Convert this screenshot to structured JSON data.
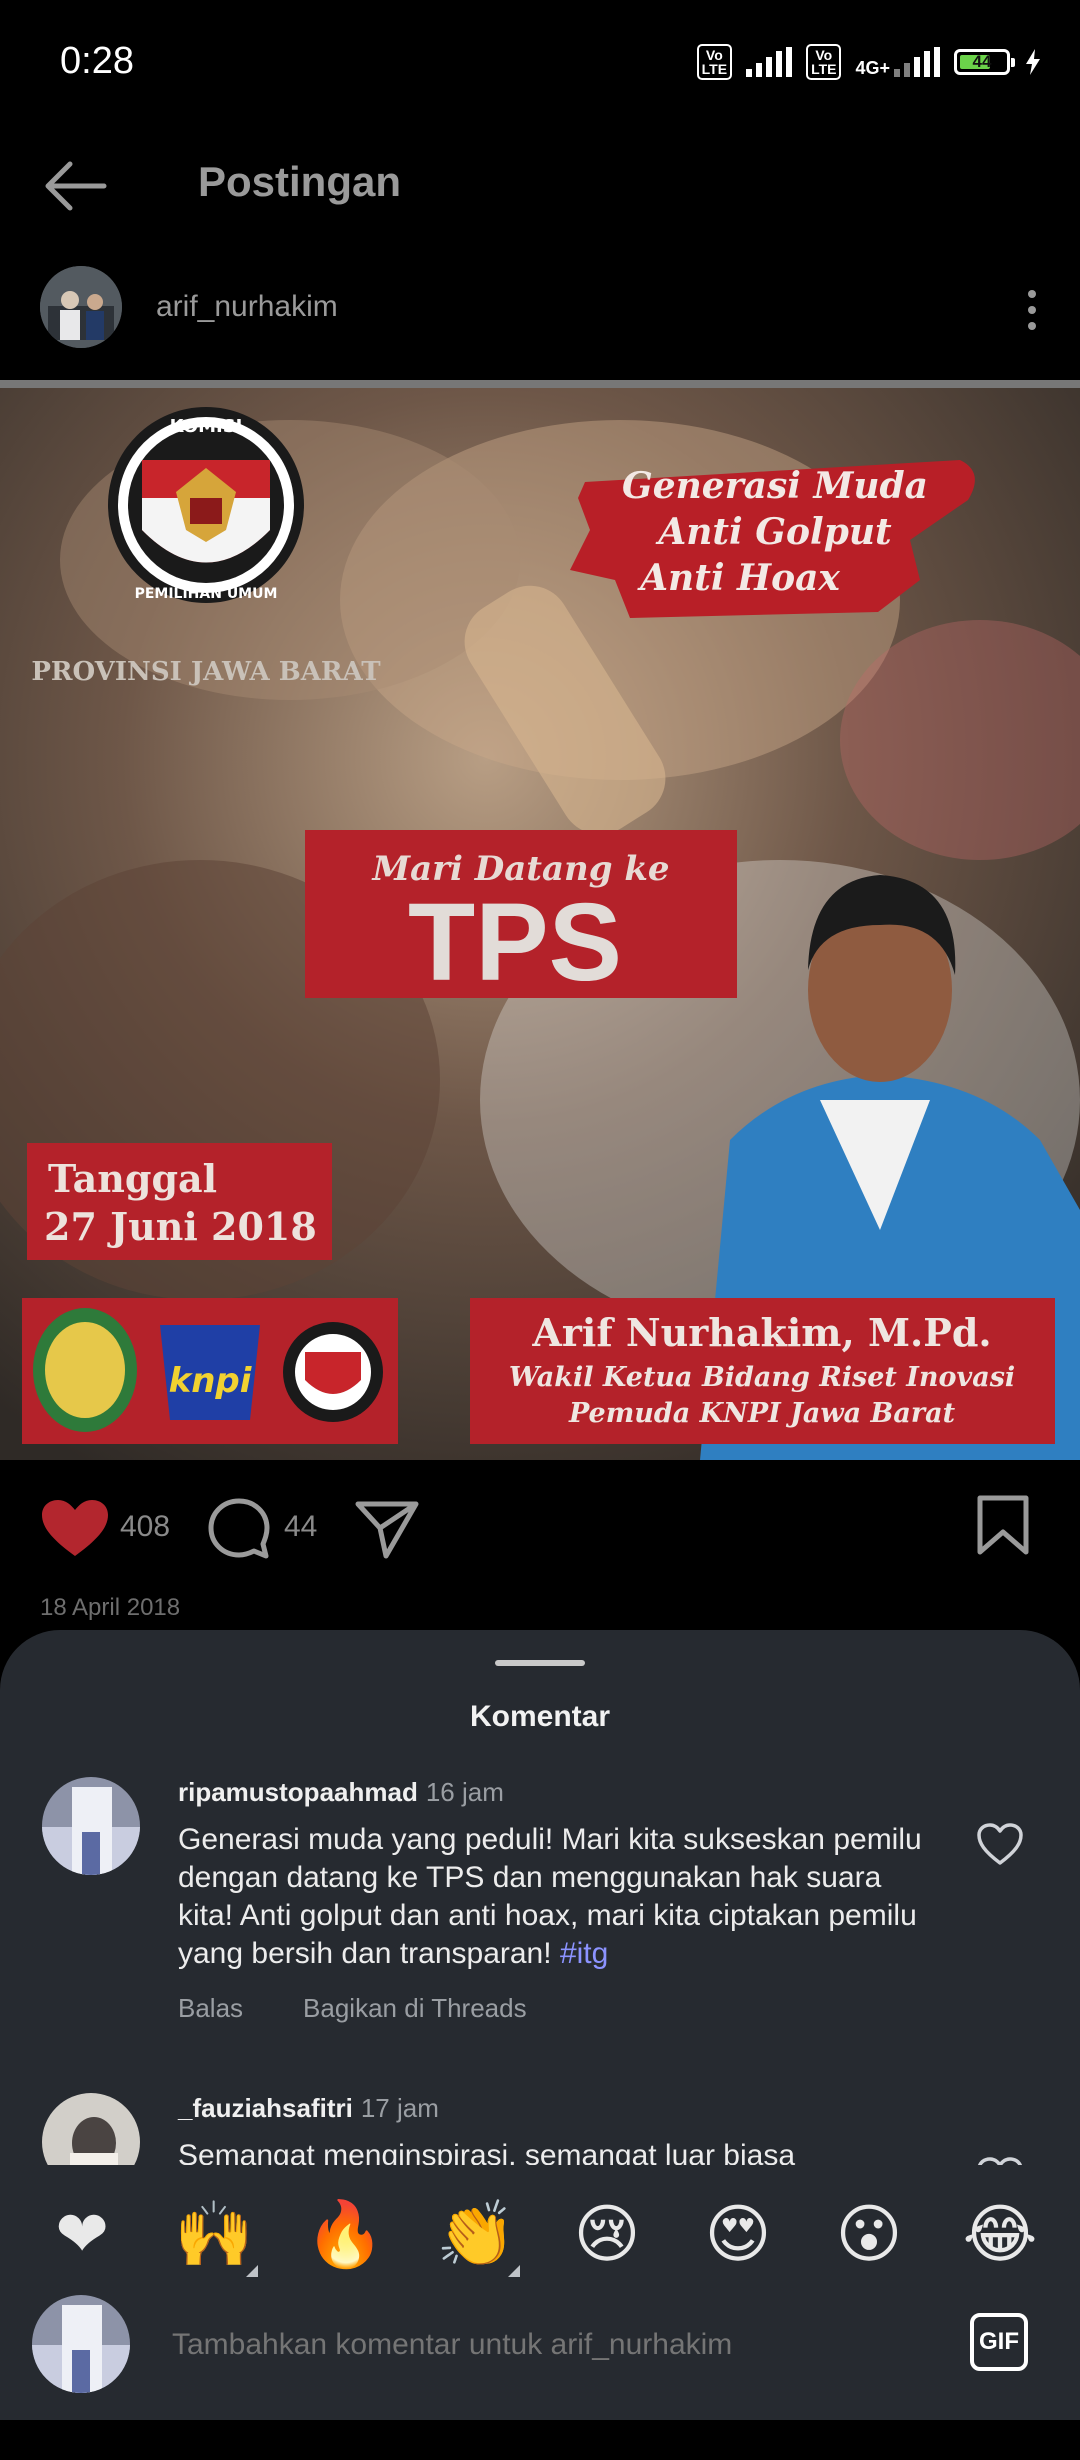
{
  "status": {
    "time": "0:28",
    "sim1": "Vo LTE",
    "sim2": "Vo LTE",
    "network": "4G+",
    "battery": "44"
  },
  "appbar": {
    "title": "Postingan"
  },
  "post": {
    "username": "arif_nurhakim",
    "image": {
      "org_line1": "KOMISI",
      "org_line2": "PEMILIHAN UMUM",
      "province": "PROVINSI JAWA BARAT",
      "slogan": [
        "Generasi Muda",
        "Anti Golput",
        "Anti Hoax"
      ],
      "cta_small": "Mari Datang ke",
      "cta_big": "TPS",
      "date_label": "Tanggal",
      "date_value": "27 Juni 2018",
      "badge_knpi": "knpi",
      "person_name": "Arif Nurhakim, M.Pd.",
      "person_role1": "Wakil Ketua Bidang Riset Inovasi",
      "person_role2": "Pemuda KNPI Jawa Barat"
    },
    "likes": "408",
    "comments": "44",
    "date": "18 April 2018"
  },
  "sheet": {
    "title": "Komentar",
    "comments": [
      {
        "user": "ripamustopaahmad",
        "time": "16 jam",
        "text": "Generasi muda yang peduli!  Mari kita sukseskan pemilu dengan datang ke TPS dan menggunakan hak suara kita! Anti golput dan anti hoax, mari kita ciptakan pemilu yang bersih dan transparan!",
        "hashtag": "#itg",
        "reply": "Balas",
        "share": "Bagikan di Threads"
      },
      {
        "user": "_fauziahsafitri",
        "time": "17 jam",
        "text": "Semangat menginspirasi, semangat luar biasa"
      }
    ],
    "emojis": [
      "❤",
      "🙌",
      "🔥",
      "👏",
      "😢",
      "😍",
      "😮",
      "😂"
    ],
    "composer_placeholder": "Tambahkan komentar untuk arif_nurhakim",
    "gif_label": "GIF"
  },
  "colors": {
    "background": "#000000",
    "sheet": "#262a30",
    "like_red": "#b3262e",
    "hashtag": "#8c93ff"
  }
}
